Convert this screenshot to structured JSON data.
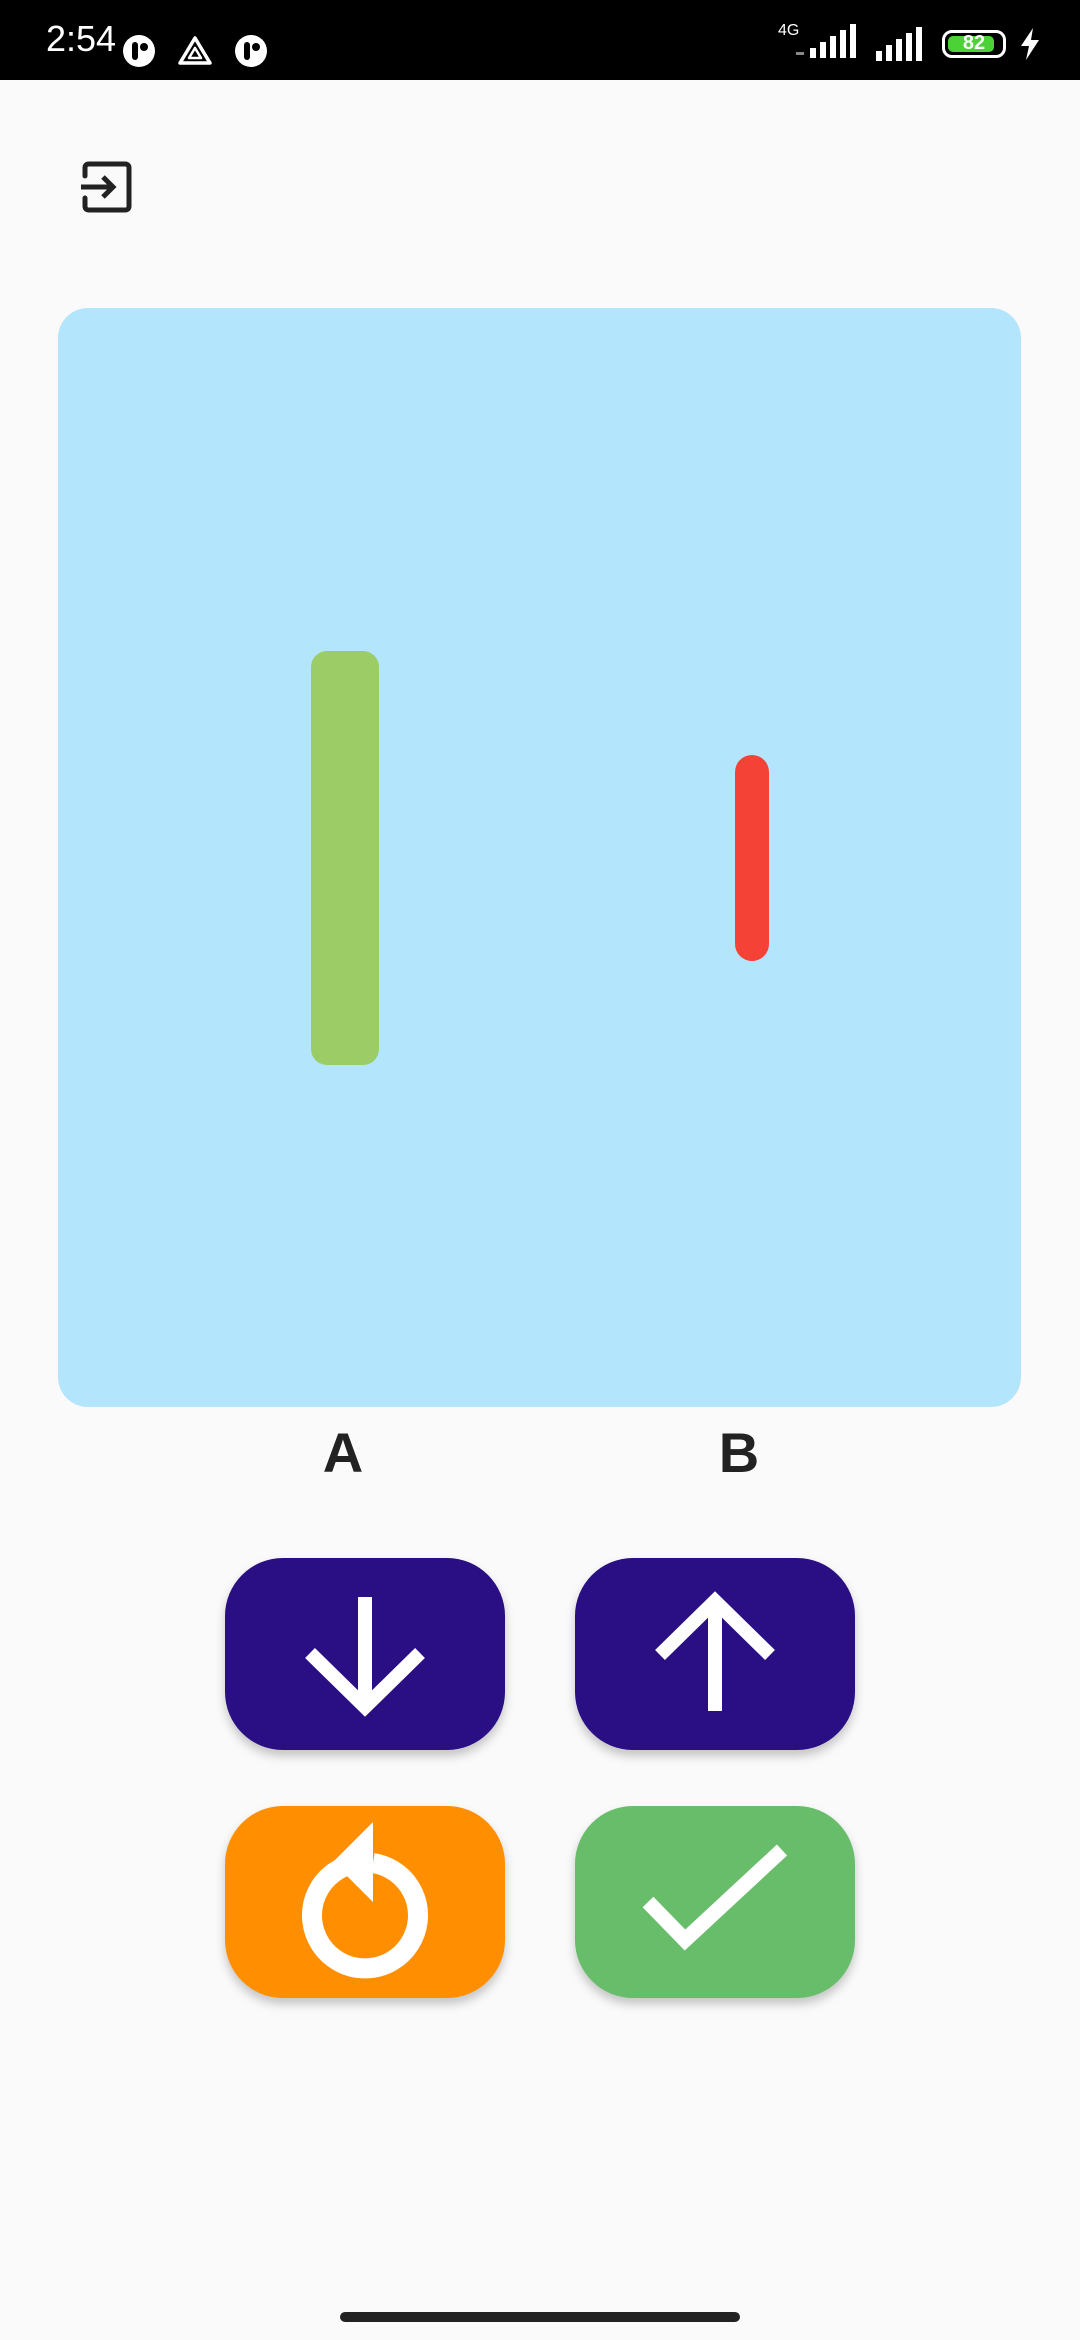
{
  "status_bar": {
    "time": "2:54",
    "network_label": "4G",
    "battery_percent": "82",
    "battery_level": 0.82,
    "icons": [
      "notification-app-icon",
      "drive-icon",
      "notification-app-icon",
      "signal-icon",
      "signal-icon",
      "battery-icon",
      "charging-icon"
    ]
  },
  "toolbar": {
    "exit_icon": "exit-to-app-icon"
  },
  "comparison": {
    "bars": [
      {
        "label": "A",
        "color": "#9ccc65",
        "relative_length": 0.377
      },
      {
        "label": "B",
        "color": "#f44336",
        "relative_length": 0.187
      }
    ],
    "panel_color": "#b3e5fc"
  },
  "controls": {
    "decrease_icon": "arrow-down-icon",
    "increase_icon": "arrow-up-icon",
    "reset_icon": "refresh-icon",
    "confirm_icon": "check-icon",
    "colors": {
      "arrow_buttons": "#2a0e83",
      "reset_button": "#ff8f00",
      "confirm_button": "#68bd6b"
    }
  }
}
